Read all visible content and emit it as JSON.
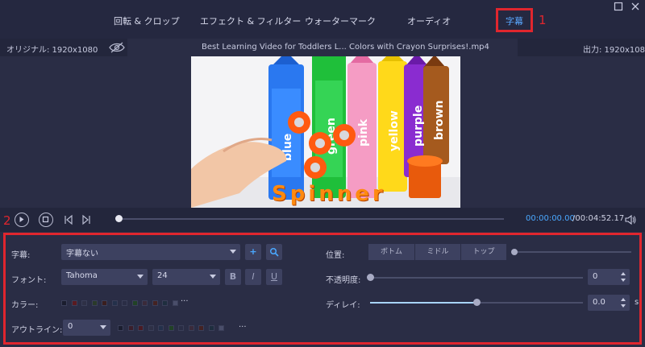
{
  "tabs": [
    {
      "label": "回転 & クロップ"
    },
    {
      "label": "エフェクト & フィルター"
    },
    {
      "label": "ウォーターマーク"
    },
    {
      "label": "オーディオ"
    },
    {
      "label": "字幕"
    }
  ],
  "annotations": {
    "marker1": "1",
    "marker2": "2"
  },
  "info": {
    "original": "オリジナル: 1920x1080",
    "filename": "Best Learning Video for Toddlers L... Colors with Crayon Surprises!.mp4",
    "output": "出力: 1920x1080"
  },
  "video": {
    "crayon_labels": [
      "blue",
      "green",
      "pink",
      "yellow",
      "purple",
      "brown"
    ],
    "caption": "Spinner"
  },
  "playback": {
    "current_time": "00:00:00.00",
    "total_time": "/00:04:52.17",
    "progress": 0
  },
  "subtitle": {
    "label": "字幕:",
    "value": "字幕ない",
    "add_symbol": "+"
  },
  "font": {
    "label": "フォント:",
    "family": "Tahoma",
    "size": "24",
    "bold": "B",
    "italic": "I",
    "underline": "U"
  },
  "color": {
    "label": "カラー:",
    "swatches": [
      "#1a1d2e",
      "#5a1a20",
      "#2e3046",
      "#2a3a2a",
      "#3a1e1e",
      "#23304a",
      "#2a2d45",
      "#214226",
      "#3a2a3a",
      "#442222",
      "#1e2e3e",
      "#4a4e6a"
    ],
    "more": "···"
  },
  "outline": {
    "label": "アウトライン:",
    "value": "0",
    "swatches": [
      "#1a1d2e",
      "#3a1e2a",
      "#4a1a22",
      "#2e3046",
      "#23304a",
      "#214226",
      "#2a2d45",
      "#3a2a3a",
      "#442222",
      "#1e2e3e",
      "#4a4e6a"
    ],
    "more": "···"
  },
  "position": {
    "label": "位置:",
    "options": [
      "ボトム",
      "ミドル",
      "トップ"
    ]
  },
  "opacity": {
    "label": "不透明度:",
    "value": "0",
    "level": 0
  },
  "delay": {
    "label": "ディレイ:",
    "value": "0.0",
    "unit": "s",
    "level": 0.5
  },
  "colors": {
    "accent": "#4aa8ff",
    "highlight_red": "#e0262e"
  }
}
